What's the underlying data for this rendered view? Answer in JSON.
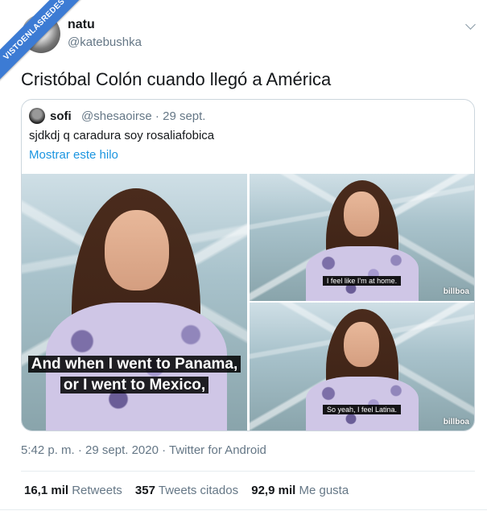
{
  "watermark": "VISTOENLASREDES",
  "tweet": {
    "display_name": "natu",
    "handle": "@katebushka",
    "text": "Cristóbal Colón cuando llegó a América",
    "meta": "5:42 p. m. · 29 sept. 2020 · Twitter for Android"
  },
  "quote": {
    "display_name": "sofi",
    "handle_date": "@shesaoirse · 29 sept.",
    "text": "sjdkdj q caradura soy rosaliafobica",
    "thread_link": "Mostrar este hilo"
  },
  "media": {
    "main_subtitle_line1": "And when I went to Panama,",
    "main_subtitle_line2": "or I went to Mexico,",
    "top_subtitle": "I feel like I'm at home.",
    "bottom_subtitle": "So yeah, I feel Latina.",
    "brand_top": "billboa",
    "brand_bottom": "billboa"
  },
  "stats": {
    "retweets_count": "16,1 mil",
    "retweets_label": "Retweets",
    "quotes_count": "357",
    "quotes_label": "Tweets citados",
    "likes_count": "92,9 mil",
    "likes_label": "Me gusta"
  },
  "colors": {
    "link": "#1b95e0",
    "secondary_text": "#657786",
    "ribbon": "#3c7bd4"
  }
}
